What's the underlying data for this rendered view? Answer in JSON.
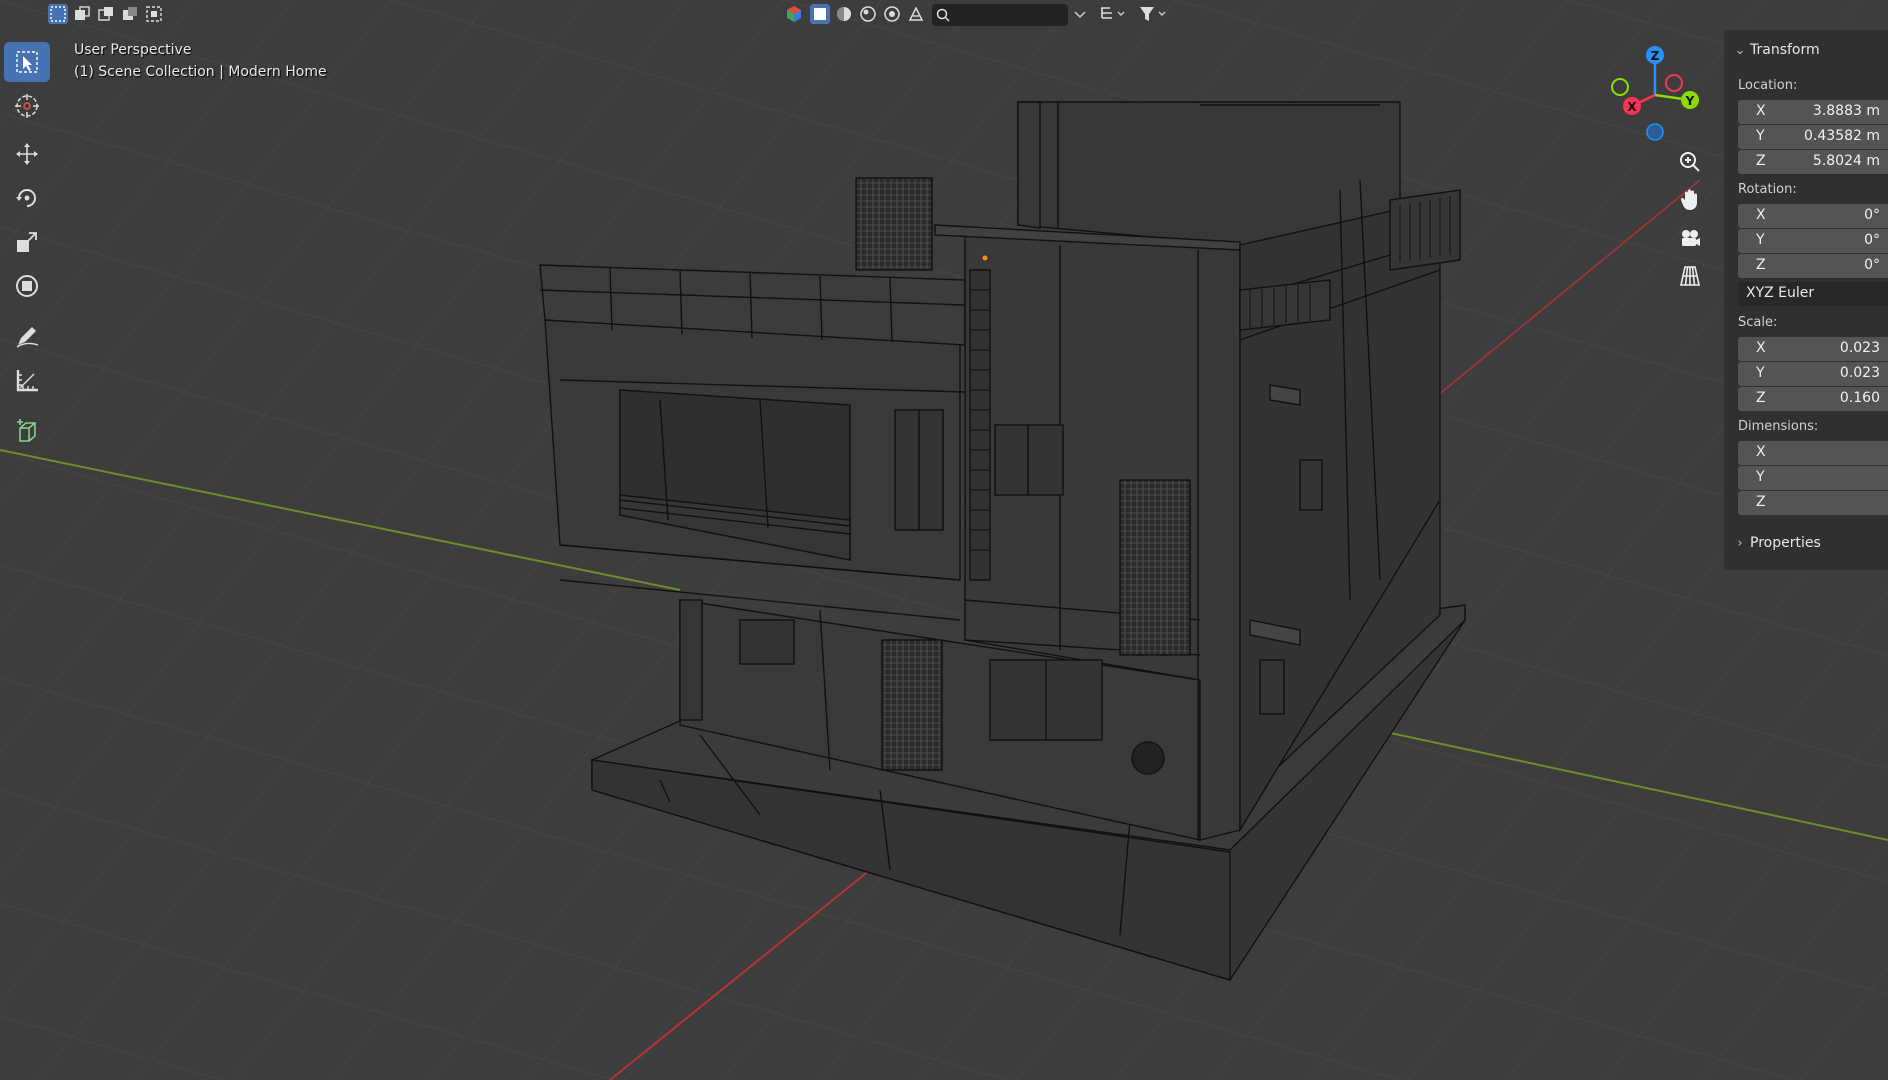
{
  "viewport": {
    "mode_label": "User Perspective",
    "collection_label": "(1) Scene Collection | Modern Home"
  },
  "header": {
    "search": {
      "value": "",
      "placeholder": ""
    }
  },
  "gizmo": {
    "z": "Z",
    "y": "Y",
    "x": "X"
  },
  "sidebar": {
    "transform": {
      "title": "Transform",
      "location_label": "Location:",
      "location": [
        {
          "axis": "X",
          "value": "3.8883 m"
        },
        {
          "axis": "Y",
          "value": "0.43582 m"
        },
        {
          "axis": "Z",
          "value": "5.8024 m"
        }
      ],
      "rotation_label": "Rotation:",
      "rotation": [
        {
          "axis": "X",
          "value": "0°"
        },
        {
          "axis": "Y",
          "value": "0°"
        },
        {
          "axis": "Z",
          "value": "0°"
        }
      ],
      "rotation_mode": "XYZ Euler",
      "scale_label": "Scale:",
      "scale": [
        {
          "axis": "X",
          "value": "0.023"
        },
        {
          "axis": "Y",
          "value": "0.023"
        },
        {
          "axis": "Z",
          "value": "0.160"
        }
      ],
      "dimensions_label": "Dimensions:",
      "dimensions": [
        {
          "axis": "X",
          "value": ""
        },
        {
          "axis": "Y",
          "value": ""
        },
        {
          "axis": "Z",
          "value": ""
        }
      ]
    },
    "properties": {
      "title": "Properties"
    }
  },
  "colors": {
    "accent": "#4772b3",
    "axis_x": "#ff3352",
    "axis_y": "#8bdc00",
    "axis_z": "#2890ff"
  }
}
